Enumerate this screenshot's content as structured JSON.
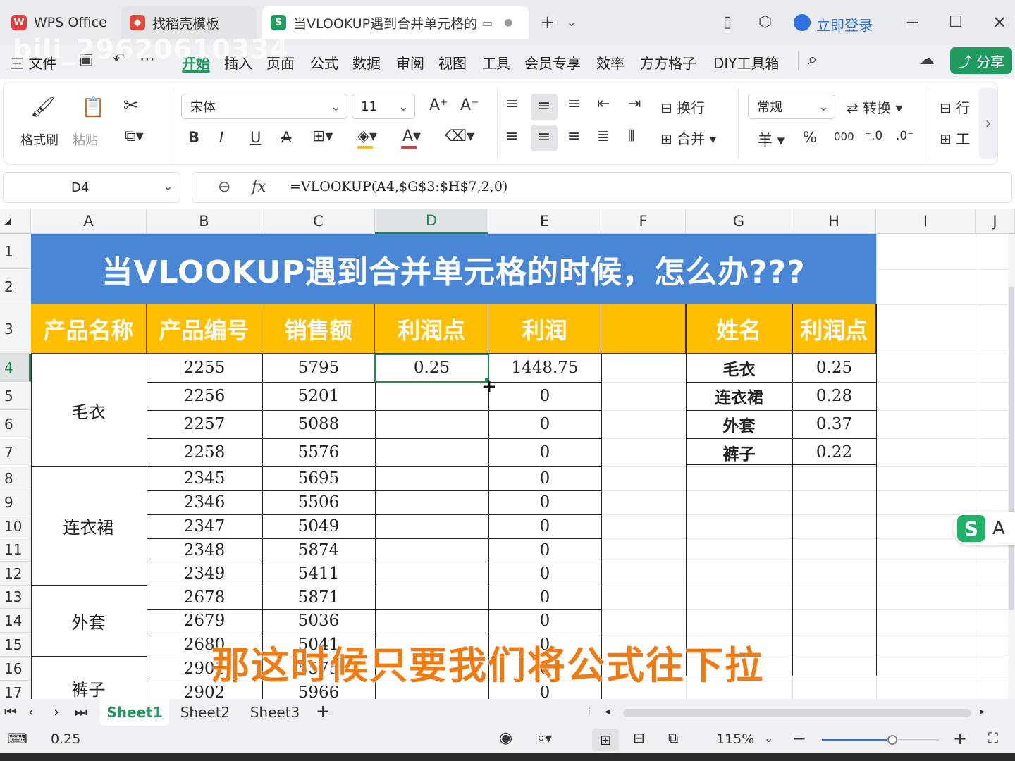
{
  "titlebar": {
    "tabs": [
      {
        "label": "WPS Office",
        "icon": "wps-logo"
      },
      {
        "label": "找稻壳模板",
        "icon": "docer-logo"
      },
      {
        "label": "当VLOOKUP遇到合并单元格的",
        "icon": "spreadsheet-s-logo"
      }
    ],
    "login_label": "立即登录"
  },
  "watermark": "bili_29620610334",
  "menu": {
    "items": [
      "三 文件",
      "开始",
      "插入",
      "页面",
      "公式",
      "数据",
      "审阅",
      "视图",
      "工具",
      "会员专享",
      "效率",
      "方方格子",
      "DIY工具箱"
    ],
    "active": "开始",
    "share_label": "分享"
  },
  "ribbon": {
    "format_painter": "格式刷",
    "paste": "粘贴",
    "font_name": "宋体",
    "font_size": "11",
    "wrap": "换行",
    "merge": "合并",
    "number_format": "常规",
    "convert": "转换",
    "currency_symbol": "羊",
    "percent": "%",
    "thousands": "000",
    "row_label": "行",
    "work_label": "工"
  },
  "formula_bar": {
    "name_box": "D4",
    "fx": "fx",
    "formula": "=VLOOKUP(A4,$G$3:$H$7,2,0)"
  },
  "sheet": {
    "columns": [
      "A",
      "B",
      "C",
      "D",
      "E",
      "F",
      "G",
      "H",
      "I",
      "J"
    ],
    "rows": [
      "1",
      "2",
      "3",
      "4",
      "5",
      "6",
      "7",
      "8",
      "9",
      "10",
      "11",
      "12",
      "13",
      "14",
      "15",
      "16",
      "17"
    ],
    "title": "当VLOOKUP遇到合并单元格的时候，怎么办???",
    "headers": [
      "产品名称",
      "产品编号",
      "销售额",
      "利润点",
      "利润"
    ],
    "groups": [
      "毛衣",
      "连衣裙",
      "外套",
      "裤子"
    ],
    "data": [
      {
        "code": "2255",
        "sales": "5795",
        "point": "0.25",
        "profit": "1448.75"
      },
      {
        "code": "2256",
        "sales": "5201",
        "point": "",
        "profit": "0"
      },
      {
        "code": "2257",
        "sales": "5088",
        "point": "",
        "profit": "0"
      },
      {
        "code": "2258",
        "sales": "5576",
        "point": "",
        "profit": "0"
      },
      {
        "code": "2345",
        "sales": "5695",
        "point": "",
        "profit": "0"
      },
      {
        "code": "2346",
        "sales": "5506",
        "point": "",
        "profit": "0"
      },
      {
        "code": "2347",
        "sales": "5049",
        "point": "",
        "profit": "0"
      },
      {
        "code": "2348",
        "sales": "5874",
        "point": "",
        "profit": "0"
      },
      {
        "code": "2349",
        "sales": "5411",
        "point": "",
        "profit": "0"
      },
      {
        "code": "2678",
        "sales": "5871",
        "point": "",
        "profit": "0"
      },
      {
        "code": "2679",
        "sales": "5036",
        "point": "",
        "profit": "0"
      },
      {
        "code": "2680",
        "sales": "5041",
        "point": "",
        "profit": "0"
      },
      {
        "code": "2901",
        "sales": "5575",
        "point": "",
        "profit": "0"
      },
      {
        "code": "2902",
        "sales": "5966",
        "point": "",
        "profit": "0"
      }
    ],
    "lookup_headers": [
      "姓名",
      "利润点"
    ],
    "lookup": [
      {
        "name": "毛衣",
        "point": "0.25"
      },
      {
        "name": "连衣裙",
        "point": "0.28"
      },
      {
        "name": "外套",
        "point": "0.37"
      },
      {
        "name": "裤子",
        "point": "0.22"
      }
    ]
  },
  "sheet_tabs": [
    "Sheet1",
    "Sheet2",
    "Sheet3"
  ],
  "active_sheet": "Sheet1",
  "status": {
    "value": "0.25",
    "zoom": "115%",
    "zoom_level": 0.6
  },
  "subtitle": "那这时候只要我们将公式往下拉",
  "colors": {
    "title_bg": "#4a86d6",
    "header_bg": "#ffbe00",
    "accent_green": "#1f9b5f",
    "subtitle": "#f07b12"
  }
}
